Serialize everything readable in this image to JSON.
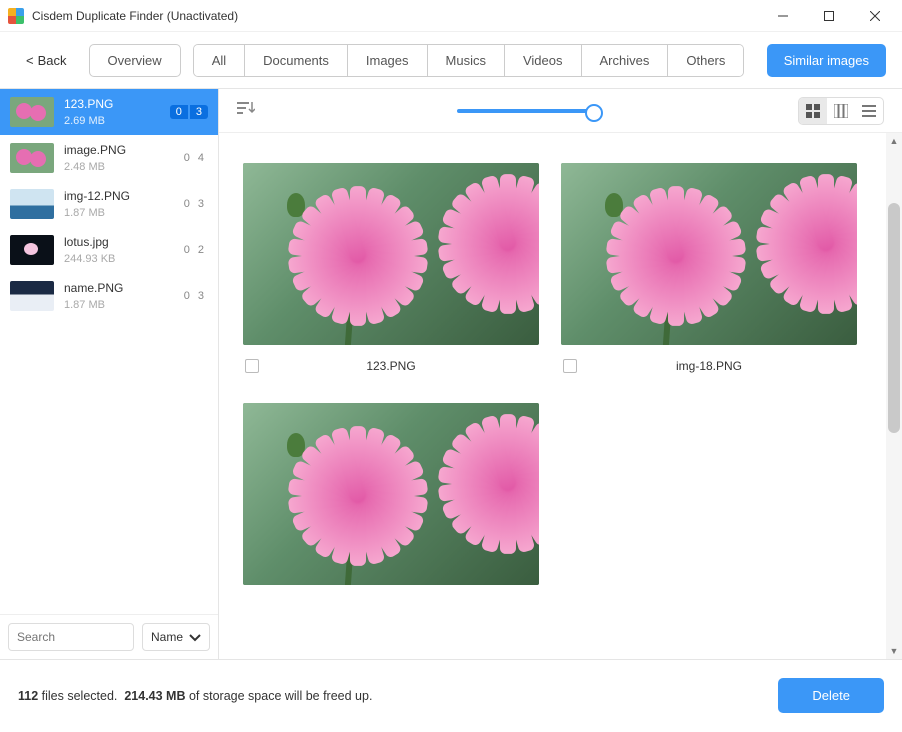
{
  "window": {
    "title": "Cisdem Duplicate Finder (Unactivated)"
  },
  "toolbar": {
    "back": "Back",
    "overview": "Overview",
    "tabs": [
      "All",
      "Documents",
      "Images",
      "Musics",
      "Videos",
      "Archives",
      "Others"
    ],
    "similar": "Similar images"
  },
  "sidebar": {
    "items": [
      {
        "name": "123.PNG",
        "size": "2.69 MB",
        "selected": 0,
        "count": 3,
        "active": true,
        "thumb": "flower"
      },
      {
        "name": "image.PNG",
        "size": "2.48 MB",
        "selected": 0,
        "count": 4,
        "active": false,
        "thumb": "flower"
      },
      {
        "name": "img-12.PNG",
        "size": "1.87 MB",
        "selected": 0,
        "count": 3,
        "active": false,
        "thumb": "mtn"
      },
      {
        "name": "lotus.jpg",
        "size": "244.93 KB",
        "selected": 0,
        "count": 2,
        "active": false,
        "thumb": "lotus"
      },
      {
        "name": "name.PNG",
        "size": "1.87 MB",
        "selected": 0,
        "count": 3,
        "active": false,
        "thumb": "snow"
      }
    ],
    "search_placeholder": "Search",
    "sort_label": "Name"
  },
  "grid": {
    "items": [
      {
        "label": "123.PNG",
        "checked": false
      },
      {
        "label": "img-18.PNG",
        "checked": false
      },
      {
        "label": "",
        "checked": false
      }
    ]
  },
  "status": {
    "files_selected": "112",
    "files_word": "files selected.",
    "size": "214.43 MB",
    "tail": "of storage space will be freed up.",
    "delete": "Delete"
  }
}
